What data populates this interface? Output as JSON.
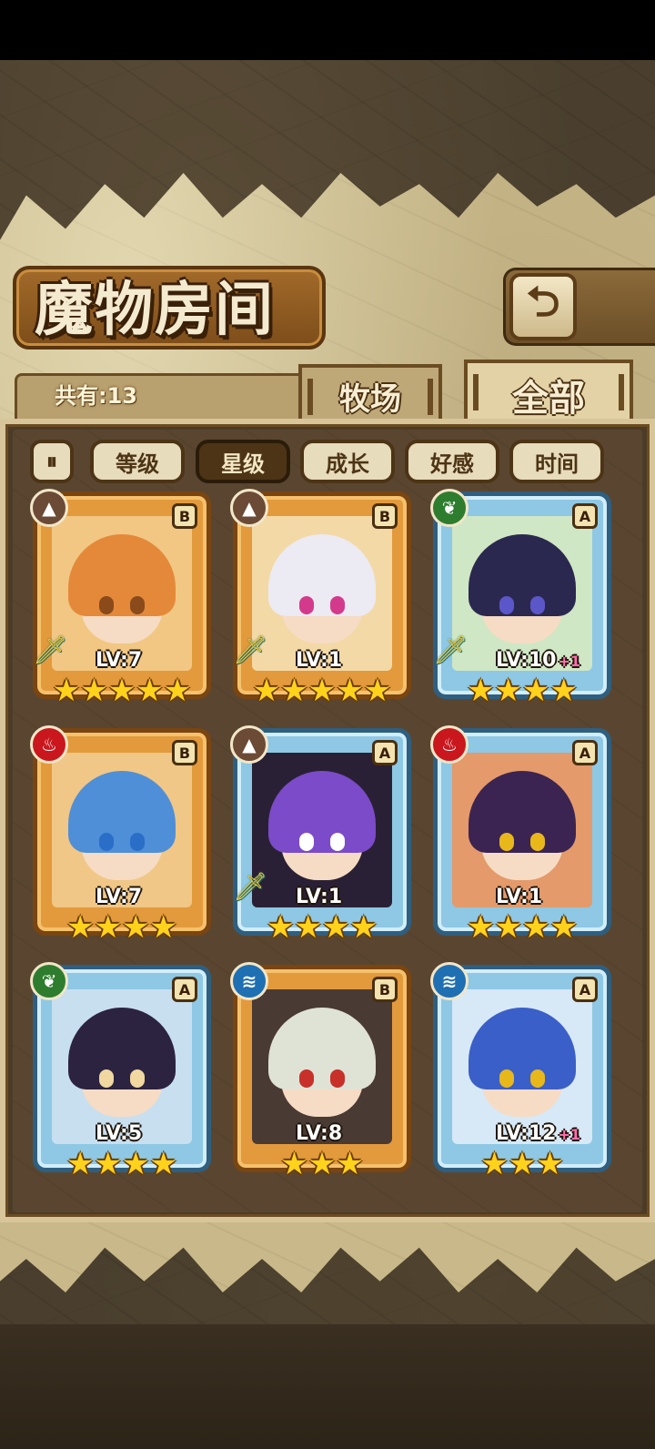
{
  "header": {
    "title": "魔物房间",
    "back_icon": "⮌"
  },
  "summary": {
    "count_label": "共有:13"
  },
  "tabs": [
    {
      "label": "牧场",
      "active": false
    },
    {
      "label": "全部",
      "active": true
    }
  ],
  "filters": {
    "toggle_icon": "⏸",
    "items": [
      {
        "label": "等级",
        "active": false
      },
      {
        "label": "星级",
        "active": true
      },
      {
        "label": "成长",
        "active": false
      },
      {
        "label": "好感",
        "active": false
      },
      {
        "label": "时间",
        "active": false
      }
    ]
  },
  "monsters": [
    {
      "element": "earth-icon",
      "element_glyph": "▲",
      "rank": "B",
      "frame": "gold",
      "weapon": true,
      "level": "LV:7",
      "bonus": "",
      "stars": 5,
      "hair": "#e4893a",
      "eyes": "#8a4a1a",
      "bg": "#f1c783"
    },
    {
      "element": "earth-icon",
      "element_glyph": "▲",
      "rank": "B",
      "frame": "gold",
      "weapon": true,
      "level": "LV:1",
      "bonus": "",
      "stars": 5,
      "hair": "#eceaf2",
      "eyes": "#d43a8c",
      "bg": "#f3d9a6"
    },
    {
      "element": "leaf-icon",
      "element_glyph": "❦",
      "rank": "A",
      "frame": "blue",
      "weapon": true,
      "level": "LV:10",
      "bonus": "+1",
      "stars": 4,
      "hair": "#2b2850",
      "eyes": "#5b57c8",
      "bg": "#cfe7c4"
    },
    {
      "element": "fire-icon",
      "element_glyph": "♨",
      "rank": "B",
      "frame": "gold",
      "weapon": false,
      "level": "LV:7",
      "bonus": "",
      "stars": 4,
      "hair": "#4f8fd8",
      "eyes": "#2a6ec8",
      "bg": "#f0c786"
    },
    {
      "element": "earth-icon",
      "element_glyph": "▲",
      "rank": "A",
      "frame": "blue",
      "weapon": true,
      "level": "LV:1",
      "bonus": "",
      "stars": 4,
      "hair": "#7b4bc9",
      "eyes": "#ffffff",
      "bg": "#2a2035"
    },
    {
      "element": "fire-icon",
      "element_glyph": "♨",
      "rank": "A",
      "frame": "blue",
      "weapon": false,
      "level": "LV:1",
      "bonus": "",
      "stars": 4,
      "hair": "#3b2452",
      "eyes": "#e8b81a",
      "bg": "#e49a6a"
    },
    {
      "element": "leaf-icon",
      "element_glyph": "❦",
      "rank": "A",
      "frame": "blue",
      "weapon": false,
      "level": "LV:5",
      "bonus": "",
      "stars": 4,
      "hair": "#2c2340",
      "eyes": "#f0d8a0",
      "bg": "#c8dff0"
    },
    {
      "element": "water-icon",
      "element_glyph": "≋",
      "rank": "B",
      "frame": "gold",
      "weapon": false,
      "level": "LV:8",
      "bonus": "",
      "stars": 3,
      "hair": "#dfe3d6",
      "eyes": "#c8302a",
      "bg": "#4a3a34"
    },
    {
      "element": "water-icon",
      "element_glyph": "≋",
      "rank": "A",
      "frame": "blue",
      "weapon": false,
      "level": "LV:12",
      "bonus": "+1",
      "stars": 3,
      "hair": "#3a5fc8",
      "eyes": "#e8b81a",
      "bg": "#d7e8f7"
    }
  ]
}
